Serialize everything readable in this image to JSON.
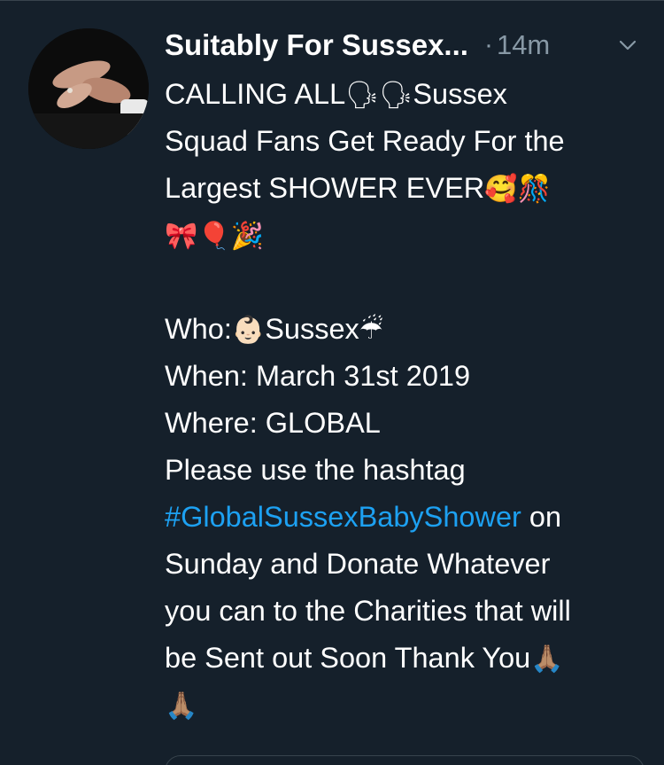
{
  "tweet": {
    "display_name": "Suitably For Sussex...",
    "dot": "·",
    "timestamp": "14m",
    "lines": {
      "l1_text": "CALLING ALL",
      "l1_emoji": "🗣🗣",
      "l1_tail": "Sussex",
      "l2": "Squad Fans Get Ready For the",
      "l3_text": "Largest SHOWER EVER",
      "l3_emoji": "🥰🎊",
      "l4_emoji": "🎀🎈🎉",
      "who_label": "Who:",
      "who_emoji": "👶🏻",
      "who_value": "Sussex",
      "who_emoji2": "☔",
      "when": "When: March 31st 2019",
      "where": "Where: GLOBAL",
      "please": "Please use the hashtag",
      "hashtag": "#GlobalSussexBabyShower",
      "hashtag_tail": " on",
      "sunday": "Sunday and Donate Whatever",
      "you_can": "you can to the Charities that will",
      "sent_out": "be Sent out Soon Thank You",
      "pray_emoji": "🙏🏽",
      "pray_emoji_2": "🙏🏽"
    }
  },
  "icons": {
    "avatar": "avatar-photo-hands",
    "chevron": "chevron-down-icon"
  },
  "colors": {
    "background": "#15202b",
    "text": "#ffffff",
    "secondary": "#8899a6",
    "link": "#1da1f2",
    "border": "#38444d"
  }
}
